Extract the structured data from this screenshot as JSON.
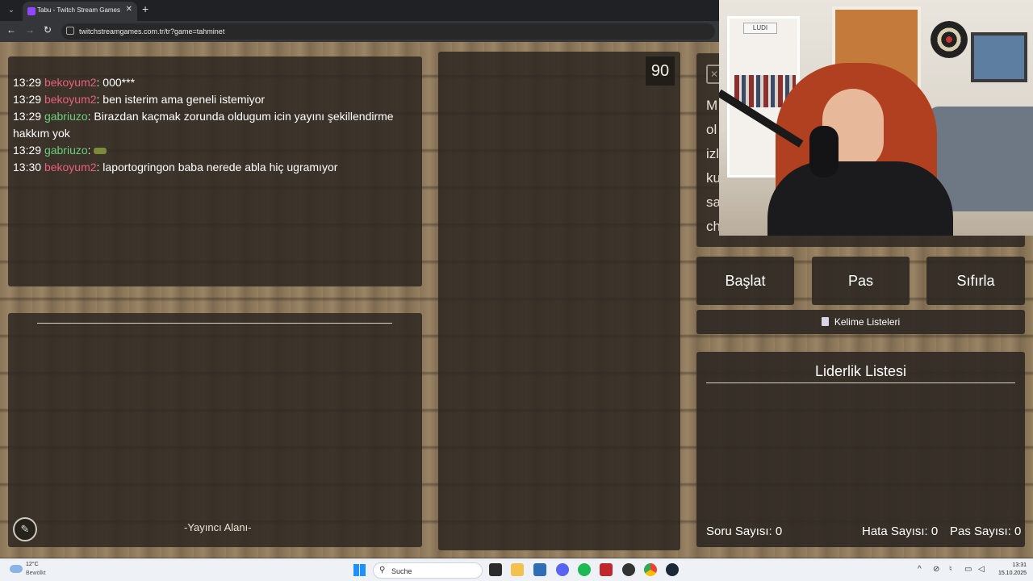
{
  "browser": {
    "tab_title": "Tabu - Twitch Stream Games",
    "url": "twitchstreamgames.com.tr/tr?game=tahminet"
  },
  "chat": {
    "messages": [
      {
        "time": "13:29",
        "user": "bekoyum2",
        "user_color": "#e9607e",
        "text": ": 000***"
      },
      {
        "time": "13:29",
        "user": "bekoyum2",
        "user_color": "#e9607e",
        "text": ": ben isterim ama geneli istemiyor"
      },
      {
        "time": "13:29",
        "user": "gabriuzo",
        "user_color": "#6ccf7c",
        "text": ": Birazdan kaçmak zorunda oldugum icin yayını şekillendirme hakkım yok"
      },
      {
        "time": "13:29",
        "user": "gabriuzo",
        "user_color": "#6ccf7c",
        "text": ": "
      },
      {
        "time": "13:30",
        "user": "bekoyum2",
        "user_color": "#e9607e",
        "text": ": laportogringon baba nerede abla hiç ugramıyor"
      }
    ]
  },
  "streamer_area": {
    "label": "-Yayıncı Alanı-"
  },
  "timer": {
    "value": "90"
  },
  "card": {
    "partial_lines": [
      "M",
      "ol",
      "izl",
      "ku",
      "sa",
      "ch"
    ]
  },
  "controls": {
    "start": "Başlat",
    "pass": "Pas",
    "reset": "Sıfırla",
    "word_lists": "Kelime Listeleri"
  },
  "leaderboard": {
    "title": "Liderlik Listesi",
    "question_count_label": "Soru Sayısı:",
    "question_count": "0",
    "error_count_label": "Hata Sayısı:",
    "error_count": "0",
    "pass_count_label": "Pas Sayısı:",
    "pass_count": "0"
  },
  "webcam": {
    "sign_text": "LUDI"
  },
  "taskbar": {
    "weather_temp": "12°C",
    "weather_desc": "Bewölkt",
    "search_placeholder": "Suche",
    "time": "13:31",
    "date": "15.10.2025"
  }
}
